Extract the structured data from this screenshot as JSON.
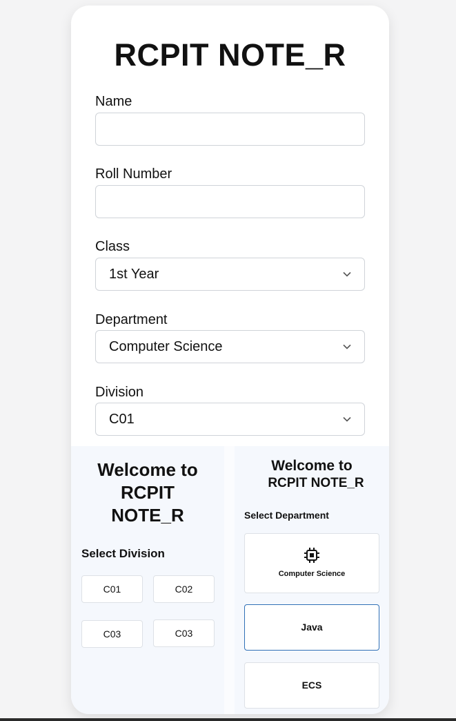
{
  "app": {
    "title": "RCPIT NOTE_R"
  },
  "form": {
    "name": {
      "label": "Name",
      "value": ""
    },
    "roll": {
      "label": "Roll Number",
      "value": ""
    },
    "class": {
      "label": "Class",
      "selected": "1st Year"
    },
    "department": {
      "label": "Department",
      "selected": "Computer Science"
    },
    "division": {
      "label": "Division",
      "selected": "C01"
    }
  },
  "division_panel": {
    "welcome_line1": "Welcome to",
    "welcome_line2": "RCPIT",
    "welcome_line3": "NOTE_R",
    "select_label": "Select Division",
    "buttons": [
      "C01",
      "C02",
      "C03",
      "C03"
    ]
  },
  "department_panel": {
    "welcome_line1": "Welcome to",
    "welcome_line2": "RCPIT NOTE_R",
    "select_label": "Select Department",
    "items": [
      {
        "label": "Computer Science",
        "icon": "cpu-chip-icon"
      },
      {
        "label": "Java"
      },
      {
        "label": "ECS"
      }
    ]
  }
}
